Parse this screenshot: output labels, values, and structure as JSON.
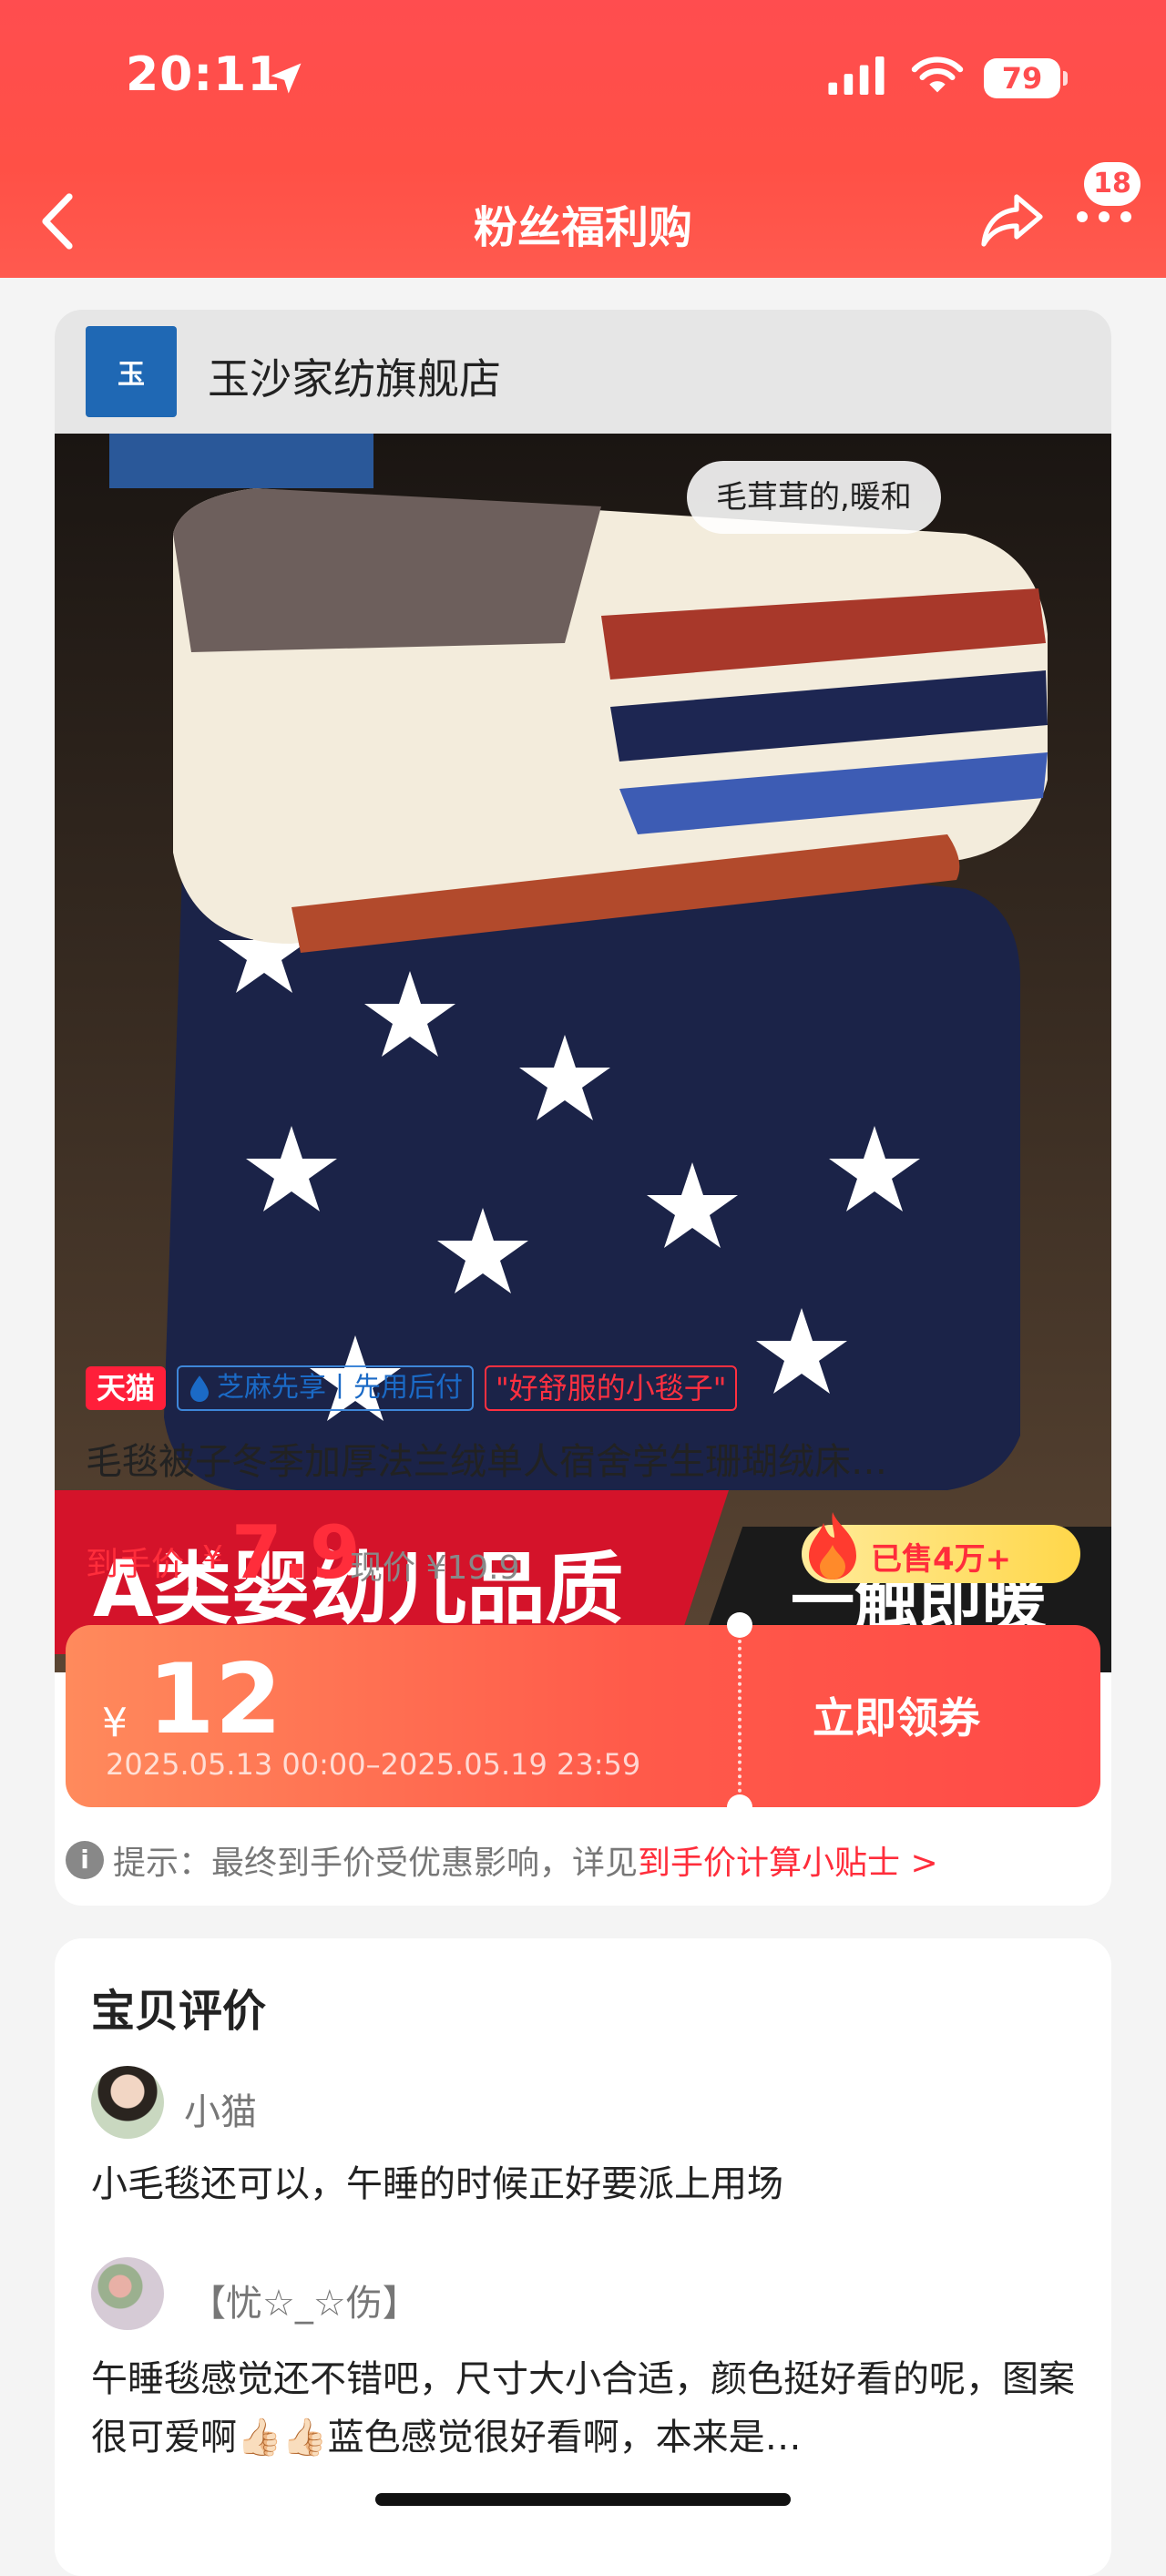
{
  "status_bar": {
    "time": "20:11",
    "battery": "79"
  },
  "header": {
    "title": "粉丝福利购",
    "badge_count": "18"
  },
  "store": {
    "name": "玉沙家纺旗舰店",
    "logo_text": "玉"
  },
  "image": {
    "tag": "毛茸茸的,暖和",
    "banner_left": "A类婴幼儿品质",
    "banner_right": "一触即暖"
  },
  "product": {
    "tags": {
      "tmall": "天猫",
      "zhima": "芝麻先享丨先用后付",
      "quote": "\"好舒服的小毯子\""
    },
    "title": "毛毯被子冬季加厚法兰绒单人宿舍学生珊瑚绒床…",
    "price_label": "到手价",
    "price_currency": "¥",
    "price_value": "7.9",
    "price_now": "现价 ¥19.9",
    "sold": "已售4万+"
  },
  "coupon": {
    "currency": "¥",
    "amount": "12",
    "validity": "2025.05.13 00:00–2025.05.19 23:59",
    "button": "立即领券"
  },
  "tip": {
    "text": "提示：最终到手价受优惠影响，详见",
    "link": "到手价计算小贴士 >"
  },
  "reviews": {
    "title": "宝贝评价",
    "items": [
      {
        "name": "小猫",
        "text": "小毛毯还可以，午睡的时候正好要派上用场"
      },
      {
        "name": "【忧☆_☆伤】",
        "text": "午睡毯感觉还不错吧，尺寸大小合适，颜色挺好看的呢，图案很可爱啊👍🏻👍🏻蓝色感觉很好看啊，本来是…"
      }
    ]
  },
  "colors": {
    "accent": "#ff4d4f",
    "price": "#ff2d3b",
    "coupon_start": "#ff8a5c",
    "coupon_end": "#ff4a47"
  }
}
